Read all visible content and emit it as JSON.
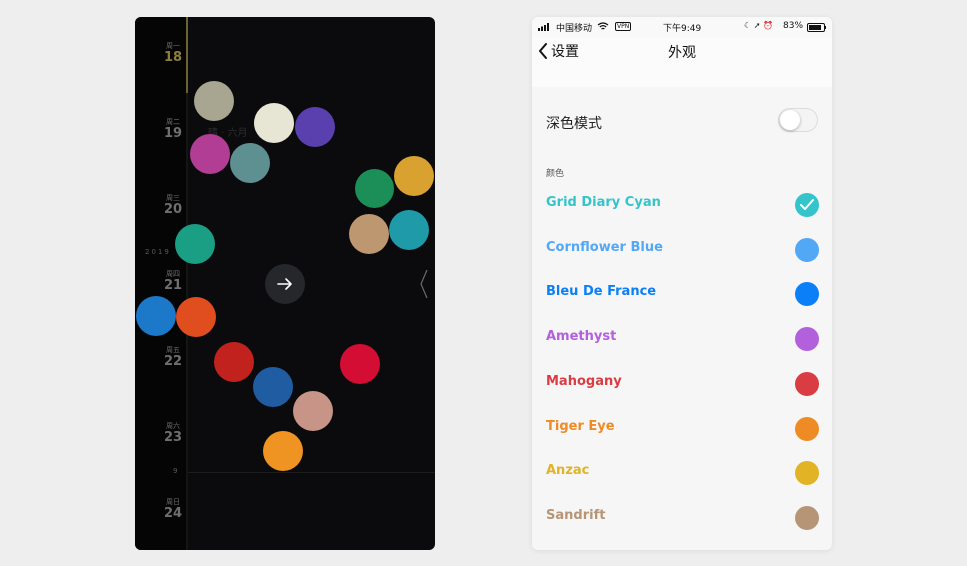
{
  "dark_phone": {
    "days": [
      {
        "dow": "周一",
        "num": "18"
      },
      {
        "dow": "周二",
        "num": "19"
      },
      {
        "dow": "周三",
        "num": "20"
      },
      {
        "dow": "周四",
        "num": "21"
      },
      {
        "dow": "周五",
        "num": "22"
      },
      {
        "dow": "周六",
        "num": "23"
      },
      {
        "dow": "周日",
        "num": "24"
      }
    ],
    "year": "2019",
    "line_label": "9",
    "ghost_text": "晴 · 六月",
    "dots": [
      "#a8a591",
      "#e7e6d4",
      "#5a3fae",
      "#b13d94",
      "#5e8f91",
      "#1b8f57",
      "#d9a230",
      "#1a9f85",
      "#bd9770",
      "#1f9aa9",
      "#1c78c8",
      "#e04e20",
      "#c1221e",
      "#d30d33",
      "#1f5ca2",
      "#c79487",
      "#ef9323"
    ]
  },
  "light_phone": {
    "status": {
      "carrier": "中国移动",
      "vpn": "VPN",
      "time": "下午9:49",
      "icons": "☾ ➚ ⏰",
      "battery": "83%"
    },
    "nav": {
      "back_label": "设置",
      "title": "外观"
    },
    "dark_mode": {
      "label": "深色模式",
      "enabled": false
    },
    "section_label": "颜色",
    "colors": [
      {
        "name": "Grid Diary Cyan",
        "color": "#33c4cc",
        "selected": true
      },
      {
        "name": "Cornflower Blue",
        "color": "#52a8f5",
        "selected": false
      },
      {
        "name": "Bleu De France",
        "color": "#0a7ff7",
        "selected": false
      },
      {
        "name": "Amethyst",
        "color": "#b260dc",
        "selected": false
      },
      {
        "name": "Mahogany",
        "color": "#d93d43",
        "selected": false
      },
      {
        "name": "Tiger Eye",
        "color": "#ef8b25",
        "selected": false
      },
      {
        "name": "Anzac",
        "color": "#e2b325",
        "selected": false
      },
      {
        "name": "Sandrift",
        "color": "#b69576",
        "selected": false
      }
    ]
  }
}
